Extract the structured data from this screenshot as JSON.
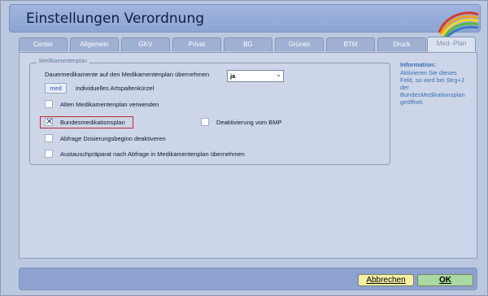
{
  "window": {
    "title": "Einstellungen Verordnung"
  },
  "tabs": [
    {
      "label": "Center",
      "active": false
    },
    {
      "label": "Allgemein",
      "active": false
    },
    {
      "label": "GKV",
      "active": false
    },
    {
      "label": "Privat",
      "active": false
    },
    {
      "label": "BG",
      "active": false
    },
    {
      "label": "Grünes",
      "active": false
    },
    {
      "label": "BTM",
      "active": false
    },
    {
      "label": "Druck",
      "active": false
    },
    {
      "label": "Med.-Plan",
      "active": true
    }
  ],
  "group": {
    "legend": "Medikamentenplan",
    "dauermed_label": "Dauermedikamente auf den  Medikamentenplan übernehmen",
    "dauermed_select": {
      "value": "ja"
    },
    "short_field": {
      "value": "med"
    },
    "short_field_label": "individuelles Artspaltenkürzel",
    "checkboxes": {
      "alten": {
        "label": "Alten Medikamentenplan verwenden",
        "checked": false
      },
      "bmp": {
        "label": "Bundesmedikationsplan",
        "checked": true
      },
      "deaktivierung": {
        "label": "Deaktivierung vom BMP",
        "checked": false
      },
      "abfrage": {
        "label": "Abfrage Dosierungsbeginn deaktiveren",
        "checked": false
      },
      "austausch": {
        "label": "Austauschpräparat nach Abfrage in Medikamentenplan übernehmen",
        "checked": false
      }
    }
  },
  "info": {
    "title": "Information:",
    "text": "Aktivieren Sie dieses Feld, so wird bei Strg+J der BundesMedikationsplan geöffnet."
  },
  "buttons": {
    "cancel": "Abbrechen",
    "ok": "OK"
  },
  "colors": {
    "title_bar": "#9fb4dd",
    "highlight": "#c1272d",
    "cancel": "#f4f0a6",
    "ok": "#a9d9a3",
    "info": "#3a6fb3"
  }
}
